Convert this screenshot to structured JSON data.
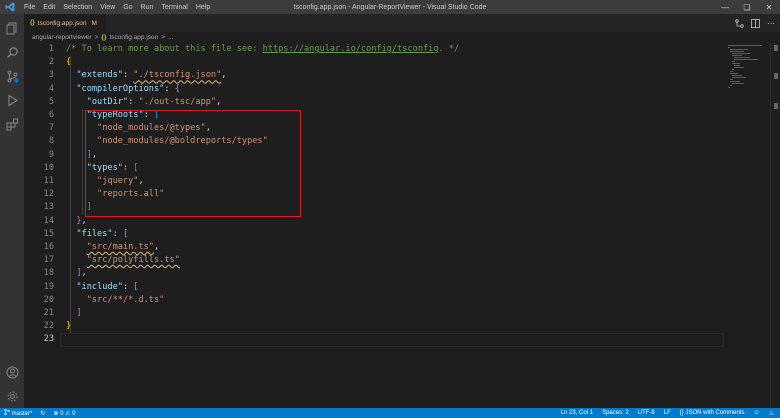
{
  "window": {
    "title": "tsconfig.app.json - Angular-ReportViewer - Visual Studio Code",
    "menu": [
      "File",
      "Edit",
      "Selection",
      "View",
      "Go",
      "Run",
      "Terminal",
      "Help"
    ]
  },
  "tab": {
    "label": "tsconfig.app.json",
    "modified": "M"
  },
  "breadcrumb": {
    "folder": "angular-reportviewer",
    "sep": ">",
    "file": "tsconfig.app.json",
    "tail": "..."
  },
  "editor": {
    "active_line": 23,
    "line_numbers": [
      "1",
      "2",
      "3",
      "4",
      "5",
      "6",
      "7",
      "8",
      "9",
      "10",
      "11",
      "12",
      "13",
      "14",
      "15",
      "16",
      "17",
      "18",
      "19",
      "20",
      "21",
      "22",
      "23"
    ],
    "lines": [
      [
        [
          "comment",
          "/* To learn more about this file see: "
        ],
        [
          "link",
          "https://angular.io/config/tsconfig"
        ],
        [
          "comment",
          ". */"
        ]
      ],
      [
        [
          "brace",
          "{"
        ]
      ],
      [
        [
          "punc",
          "  "
        ],
        [
          "key",
          "\"extends\""
        ],
        [
          "punc",
          ": "
        ],
        [
          "strsq",
          "\"./tsconfig.json\""
        ],
        [
          "punc",
          ","
        ]
      ],
      [
        [
          "punc",
          "  "
        ],
        [
          "key",
          "\"compilerOptions\""
        ],
        [
          "punc",
          ": "
        ],
        [
          "brace2",
          "{"
        ]
      ],
      [
        [
          "punc",
          "    "
        ],
        [
          "key",
          "\"outDir\""
        ],
        [
          "punc",
          ": "
        ],
        [
          "str",
          "\"./out-tsc/app\""
        ],
        [
          "punc",
          ","
        ]
      ],
      [
        [
          "punc",
          "    "
        ],
        [
          "key",
          "\"typeRoots\""
        ],
        [
          "punc",
          ": "
        ],
        [
          "brace3",
          "["
        ]
      ],
      [
        [
          "punc",
          "      "
        ],
        [
          "str",
          "\"node_modules/@types\""
        ],
        [
          "punc",
          ","
        ]
      ],
      [
        [
          "punc",
          "      "
        ],
        [
          "str",
          "\"node_modules/@boldreports/types\""
        ]
      ],
      [
        [
          "punc",
          "    "
        ],
        [
          "brace3",
          "]"
        ],
        [
          "punc",
          ","
        ]
      ],
      [
        [
          "punc",
          "    "
        ],
        [
          "key",
          "\"types\""
        ],
        [
          "punc",
          ": "
        ],
        [
          "brace3",
          "["
        ]
      ],
      [
        [
          "punc",
          "      "
        ],
        [
          "str",
          "\"jquery\""
        ],
        [
          "punc",
          ","
        ]
      ],
      [
        [
          "punc",
          "      "
        ],
        [
          "str",
          "\"reports.all\""
        ]
      ],
      [
        [
          "punc",
          "    "
        ],
        [
          "brace3",
          "]"
        ]
      ],
      [
        [
          "punc",
          "  "
        ],
        [
          "brace2",
          "}"
        ],
        [
          "punc",
          ","
        ]
      ],
      [
        [
          "punc",
          "  "
        ],
        [
          "key",
          "\"files\""
        ],
        [
          "punc",
          ": "
        ],
        [
          "brace2",
          "["
        ]
      ],
      [
        [
          "punc",
          "    "
        ],
        [
          "strsq",
          "\"src/main.ts\""
        ],
        [
          "punc",
          ","
        ]
      ],
      [
        [
          "punc",
          "    "
        ],
        [
          "strsq",
          "\"src/polyfills.ts\""
        ]
      ],
      [
        [
          "punc",
          "  "
        ],
        [
          "brace2",
          "]"
        ],
        [
          "punc",
          ","
        ]
      ],
      [
        [
          "punc",
          "  "
        ],
        [
          "key",
          "\"include\""
        ],
        [
          "punc",
          ": "
        ],
        [
          "brace2",
          "["
        ]
      ],
      [
        [
          "punc",
          "    "
        ],
        [
          "str",
          "\"src/**/*.d.ts\""
        ]
      ],
      [
        [
          "punc",
          "  "
        ],
        [
          "brace2",
          "]"
        ]
      ],
      [
        [
          "brace",
          "}"
        ]
      ],
      []
    ]
  },
  "status": {
    "branch": "master*",
    "errors": "0",
    "warnings": "0",
    "position": "Ln 23, Col 1",
    "spaces": "Spaces: 2",
    "encoding": "UTF-8",
    "eol": "LF",
    "language": "JSON with Comments"
  },
  "colors": {
    "accent": "#007acc",
    "highlight_box": "#d11f26"
  }
}
